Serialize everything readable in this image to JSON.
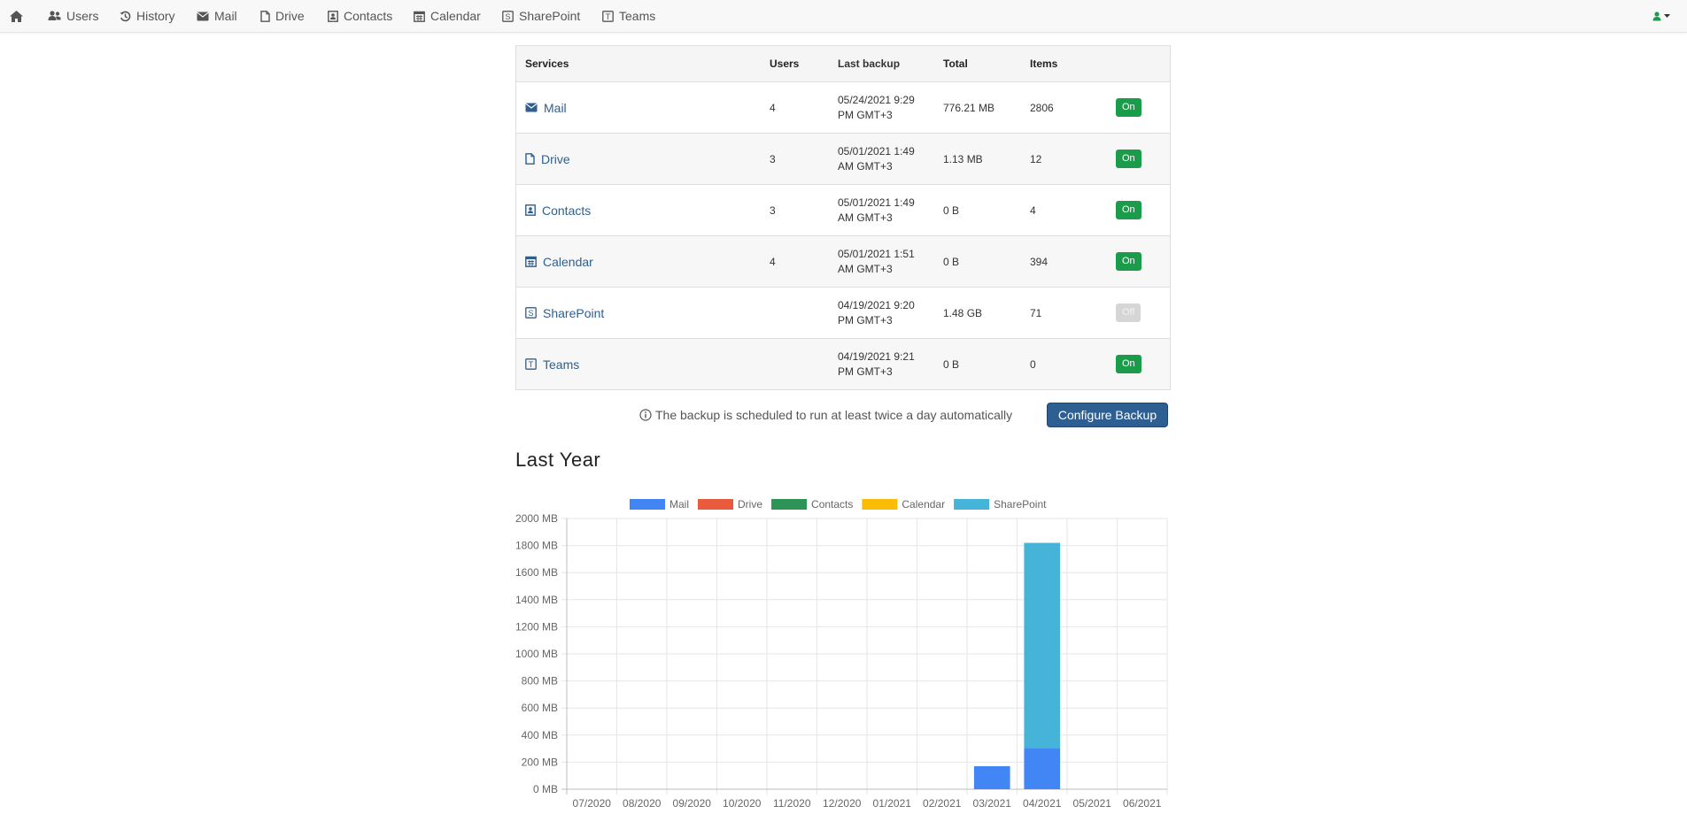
{
  "nav": {
    "items": [
      {
        "label": "Users",
        "icon": "users-icon"
      },
      {
        "label": "History",
        "icon": "history-icon"
      },
      {
        "label": "Mail",
        "icon": "envelope-icon"
      },
      {
        "label": "Drive",
        "icon": "file-icon"
      },
      {
        "label": "Contacts",
        "icon": "contact-card-icon"
      },
      {
        "label": "Calendar",
        "icon": "calendar-icon"
      },
      {
        "label": "SharePoint",
        "icon": "sharepoint-icon"
      },
      {
        "label": "Teams",
        "icon": "teams-icon"
      }
    ]
  },
  "table": {
    "headers": {
      "services": "Services",
      "users": "Users",
      "last_backup": "Last backup",
      "total": "Total",
      "items": "Items"
    },
    "rows": [
      {
        "service": "Mail",
        "users": "4",
        "backup_line1": "05/24/2021 9:29",
        "backup_line2": "PM GMT+3",
        "total": "776.21 MB",
        "items": "2806",
        "status": "On"
      },
      {
        "service": "Drive",
        "users": "3",
        "backup_line1": "05/01/2021 1:49",
        "backup_line2": "AM GMT+3",
        "total": "1.13 MB",
        "items": "12",
        "status": "On"
      },
      {
        "service": "Contacts",
        "users": "3",
        "backup_line1": "05/01/2021 1:49",
        "backup_line2": "AM GMT+3",
        "total": "0 B",
        "items": "4",
        "status": "On"
      },
      {
        "service": "Calendar",
        "users": "4",
        "backup_line1": "05/01/2021 1:51",
        "backup_line2": "AM GMT+3",
        "total": "0 B",
        "items": "394",
        "status": "On"
      },
      {
        "service": "SharePoint",
        "users": "",
        "backup_line1": "04/19/2021 9:20",
        "backup_line2": "PM GMT+3",
        "total": "1.48 GB",
        "items": "71",
        "status": "Off"
      },
      {
        "service": "Teams",
        "users": "",
        "backup_line1": "04/19/2021 9:21",
        "backup_line2": "PM GMT+3",
        "total": "0 B",
        "items": "0",
        "status": "On"
      }
    ]
  },
  "schedule_note": "The backup is scheduled to run at least twice a day automatically",
  "configure_button": "Configure Backup",
  "section_title": "Last Year",
  "colors": {
    "mail": "#4285f4",
    "drive": "#ea5a3d",
    "contacts": "#2e9455",
    "calendar": "#fbbc05",
    "sharepoint": "#46b4d9",
    "on_badge": "#1a9c4b",
    "off_badge": "#d6d6d6",
    "button": "#2e5f92"
  },
  "chart_data": {
    "type": "bar",
    "stacked": true,
    "categories": [
      "07/2020",
      "08/2020",
      "09/2020",
      "10/2020",
      "11/2020",
      "12/2020",
      "01/2021",
      "02/2021",
      "03/2021",
      "04/2021",
      "05/2021",
      "06/2021"
    ],
    "series": [
      {
        "name": "Mail",
        "color": "#4285f4",
        "values": [
          0,
          0,
          0,
          0,
          0,
          0,
          0,
          0,
          170,
          305,
          0,
          0
        ]
      },
      {
        "name": "Drive",
        "color": "#ea5a3d",
        "values": [
          0,
          0,
          0,
          0,
          0,
          0,
          0,
          0,
          0,
          0,
          0,
          0
        ]
      },
      {
        "name": "Contacts",
        "color": "#2e9455",
        "values": [
          0,
          0,
          0,
          0,
          0,
          0,
          0,
          0,
          0,
          0,
          0,
          0
        ]
      },
      {
        "name": "Calendar",
        "color": "#fbbc05",
        "values": [
          0,
          0,
          0,
          0,
          0,
          0,
          0,
          0,
          0,
          0,
          0,
          0
        ]
      },
      {
        "name": "SharePoint",
        "color": "#46b4d9",
        "values": [
          0,
          0,
          0,
          0,
          0,
          0,
          0,
          0,
          0,
          1515,
          0,
          0
        ]
      }
    ],
    "yticks": [
      "0 MB",
      "200 MB",
      "400 MB",
      "600 MB",
      "800 MB",
      "1000 MB",
      "1200 MB",
      "1400 MB",
      "1600 MB",
      "1800 MB",
      "2000 MB"
    ],
    "ylim": [
      0,
      2000
    ],
    "grid": true,
    "legend_position": "top"
  }
}
